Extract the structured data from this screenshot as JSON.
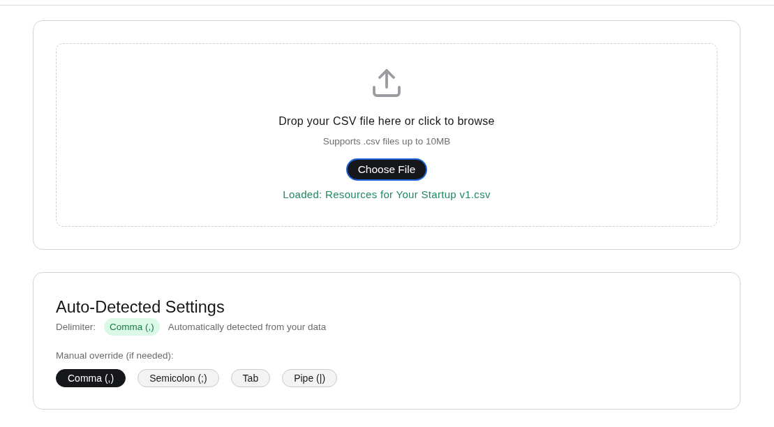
{
  "upload": {
    "prompt": "Drop your CSV file here or click to browse",
    "hint": "Supports .csv files up to 10MB",
    "button": {
      "label": "Choose File",
      "focused": true
    },
    "status": "Loaded: Resources for Your Startup v1.csv"
  },
  "settings": {
    "title": "Auto-Detected Settings",
    "delimiter_label": "Delimiter:",
    "detected": "Comma (,)",
    "detected_note": "Automatically detected from your data",
    "override_label": "Manual override (if needed):",
    "options": [
      {
        "label": "Comma (,)",
        "selected": true
      },
      {
        "label": "Semicolon (;)",
        "selected": false
      },
      {
        "label": "Tab",
        "selected": false
      },
      {
        "label": "Pipe (|)",
        "selected": false
      }
    ]
  }
}
